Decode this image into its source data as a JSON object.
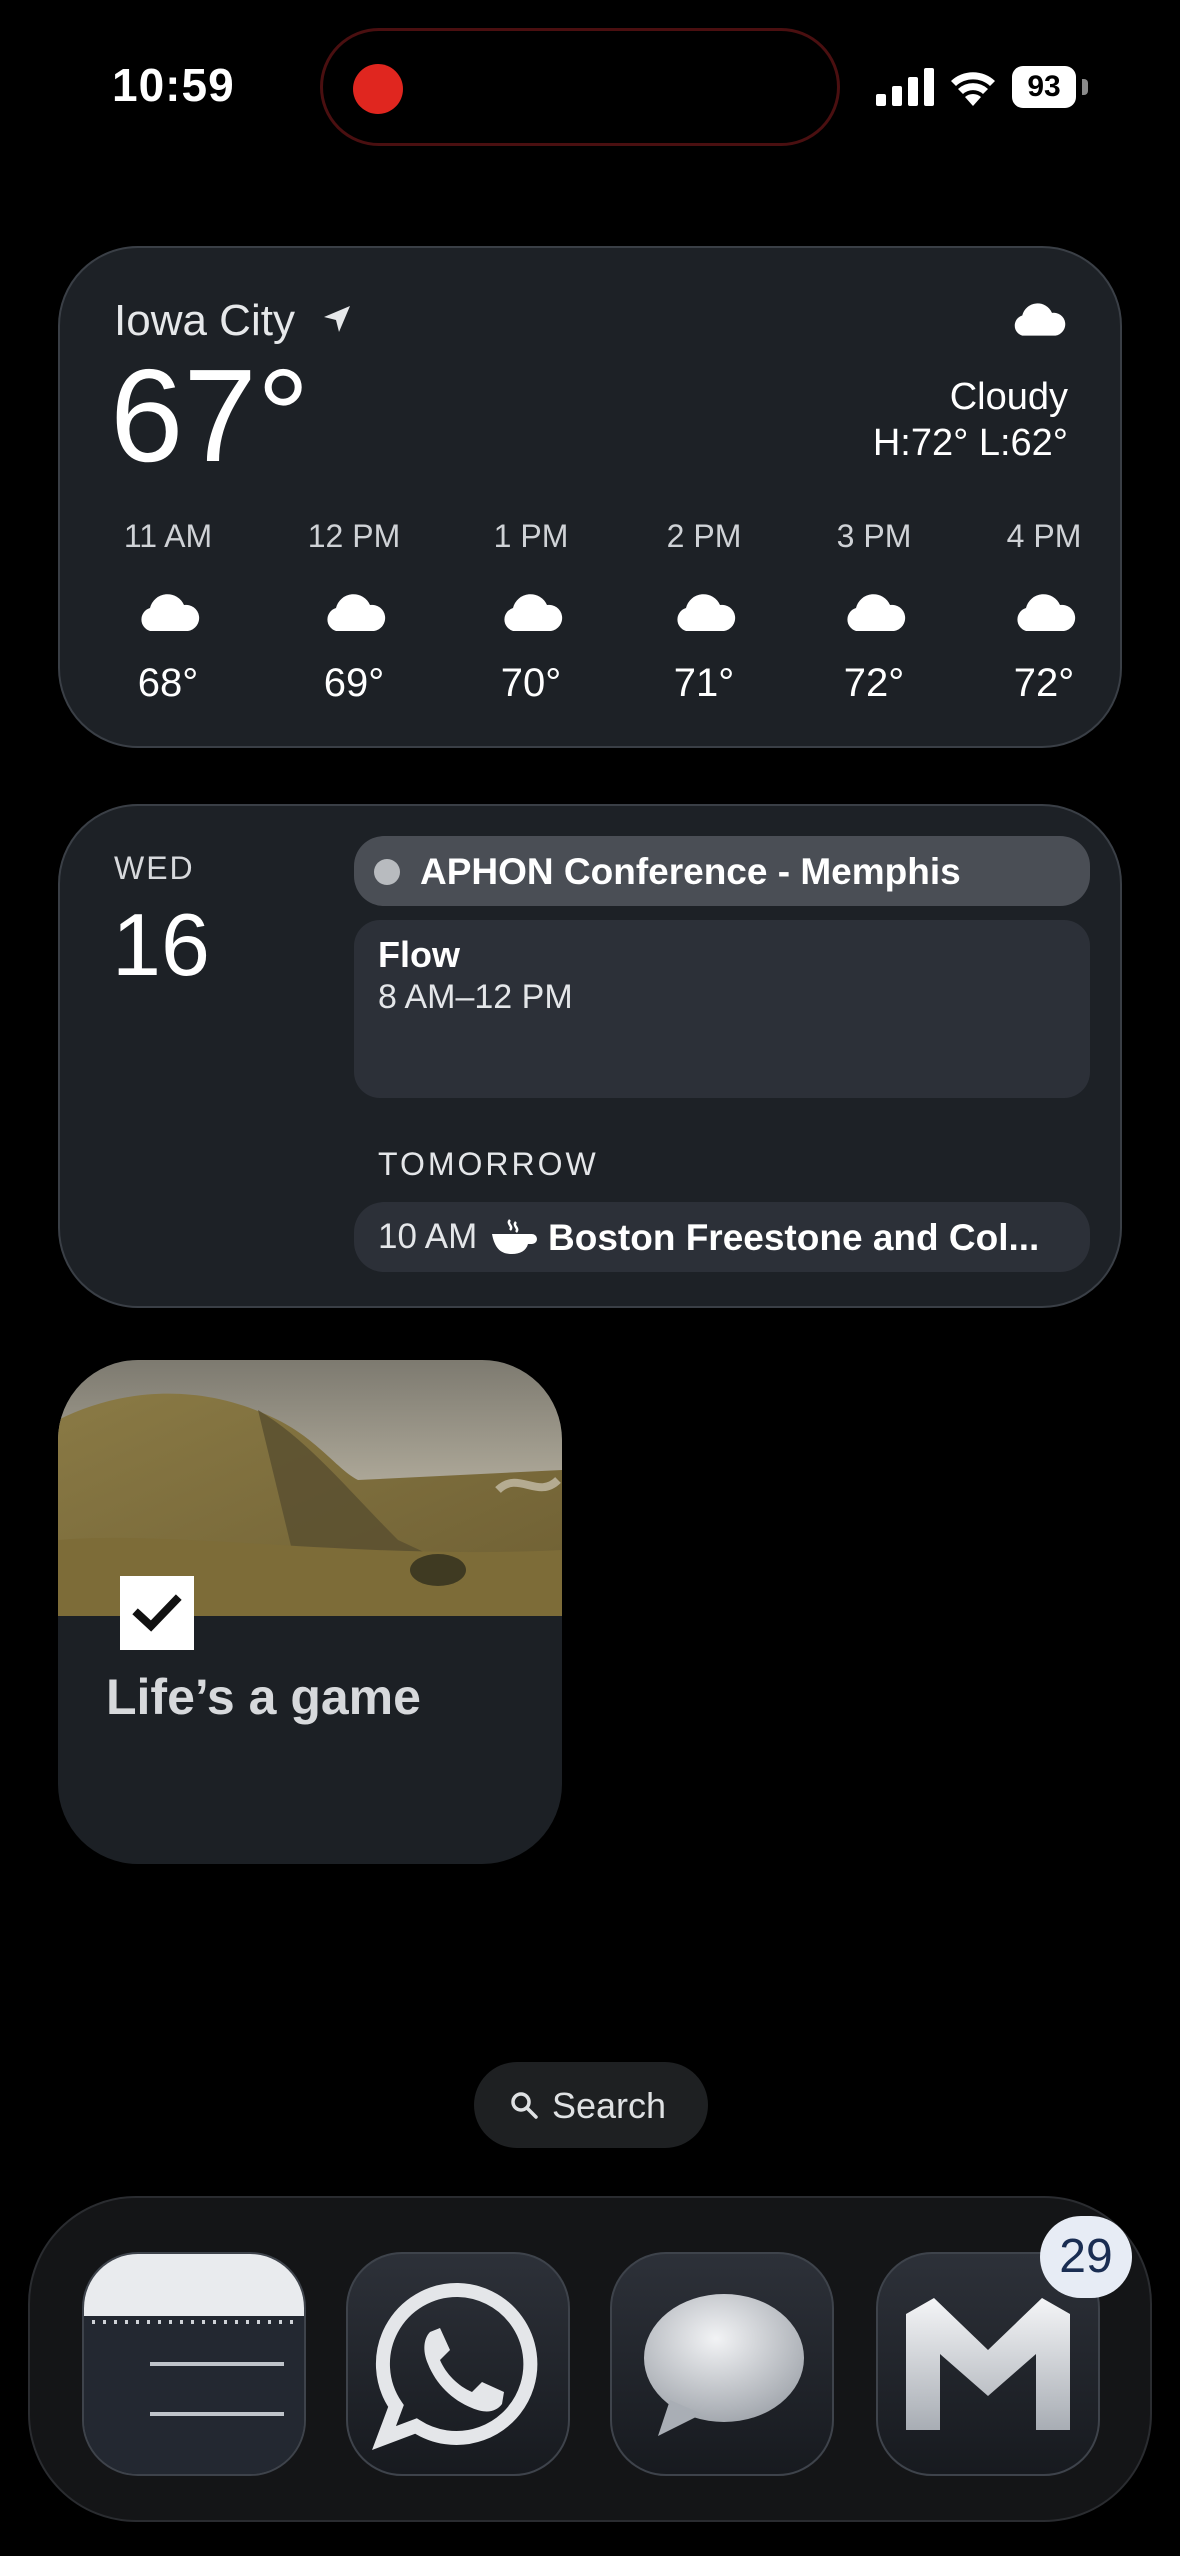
{
  "status_bar": {
    "time": "10:59",
    "battery": "93",
    "recording_color": "#e0261f"
  },
  "weather": {
    "city": "Iowa City",
    "temperature": "67°",
    "condition": "Cloudy",
    "high_low": "H:72° L:62°",
    "icon": "cloud-icon",
    "hourly": [
      {
        "label": "11 AM",
        "temp": "68°"
      },
      {
        "label": "12 PM",
        "temp": "69°"
      },
      {
        "label": "1 PM",
        "temp": "70°"
      },
      {
        "label": "2 PM",
        "temp": "71°"
      },
      {
        "label": "3 PM",
        "temp": "72°"
      },
      {
        "label": "4 PM",
        "temp": "72°"
      }
    ]
  },
  "calendar": {
    "day": "WED",
    "date": "16",
    "events": [
      {
        "title": "APHON Conference - Memphis"
      },
      {
        "title": "Flow",
        "time": "8 AM–12 PM"
      }
    ],
    "tomorrow_label": "TOMORROW",
    "tomorrow_event": {
      "time": "10 AM",
      "icon": "coffee-cup-icon",
      "title": "Boston Freestone and Col..."
    }
  },
  "note_widget": {
    "title": "Life’s a game",
    "image": "landscape-painting"
  },
  "search": {
    "label": "Search"
  },
  "dock": {
    "apps": [
      {
        "name": "Notes",
        "icon": "notes-icon"
      },
      {
        "name": "WhatsApp",
        "icon": "whatsapp-icon"
      },
      {
        "name": "Messages",
        "icon": "messages-icon"
      },
      {
        "name": "Gmail",
        "icon": "gmail-icon"
      }
    ],
    "gmail_badge": "29"
  }
}
